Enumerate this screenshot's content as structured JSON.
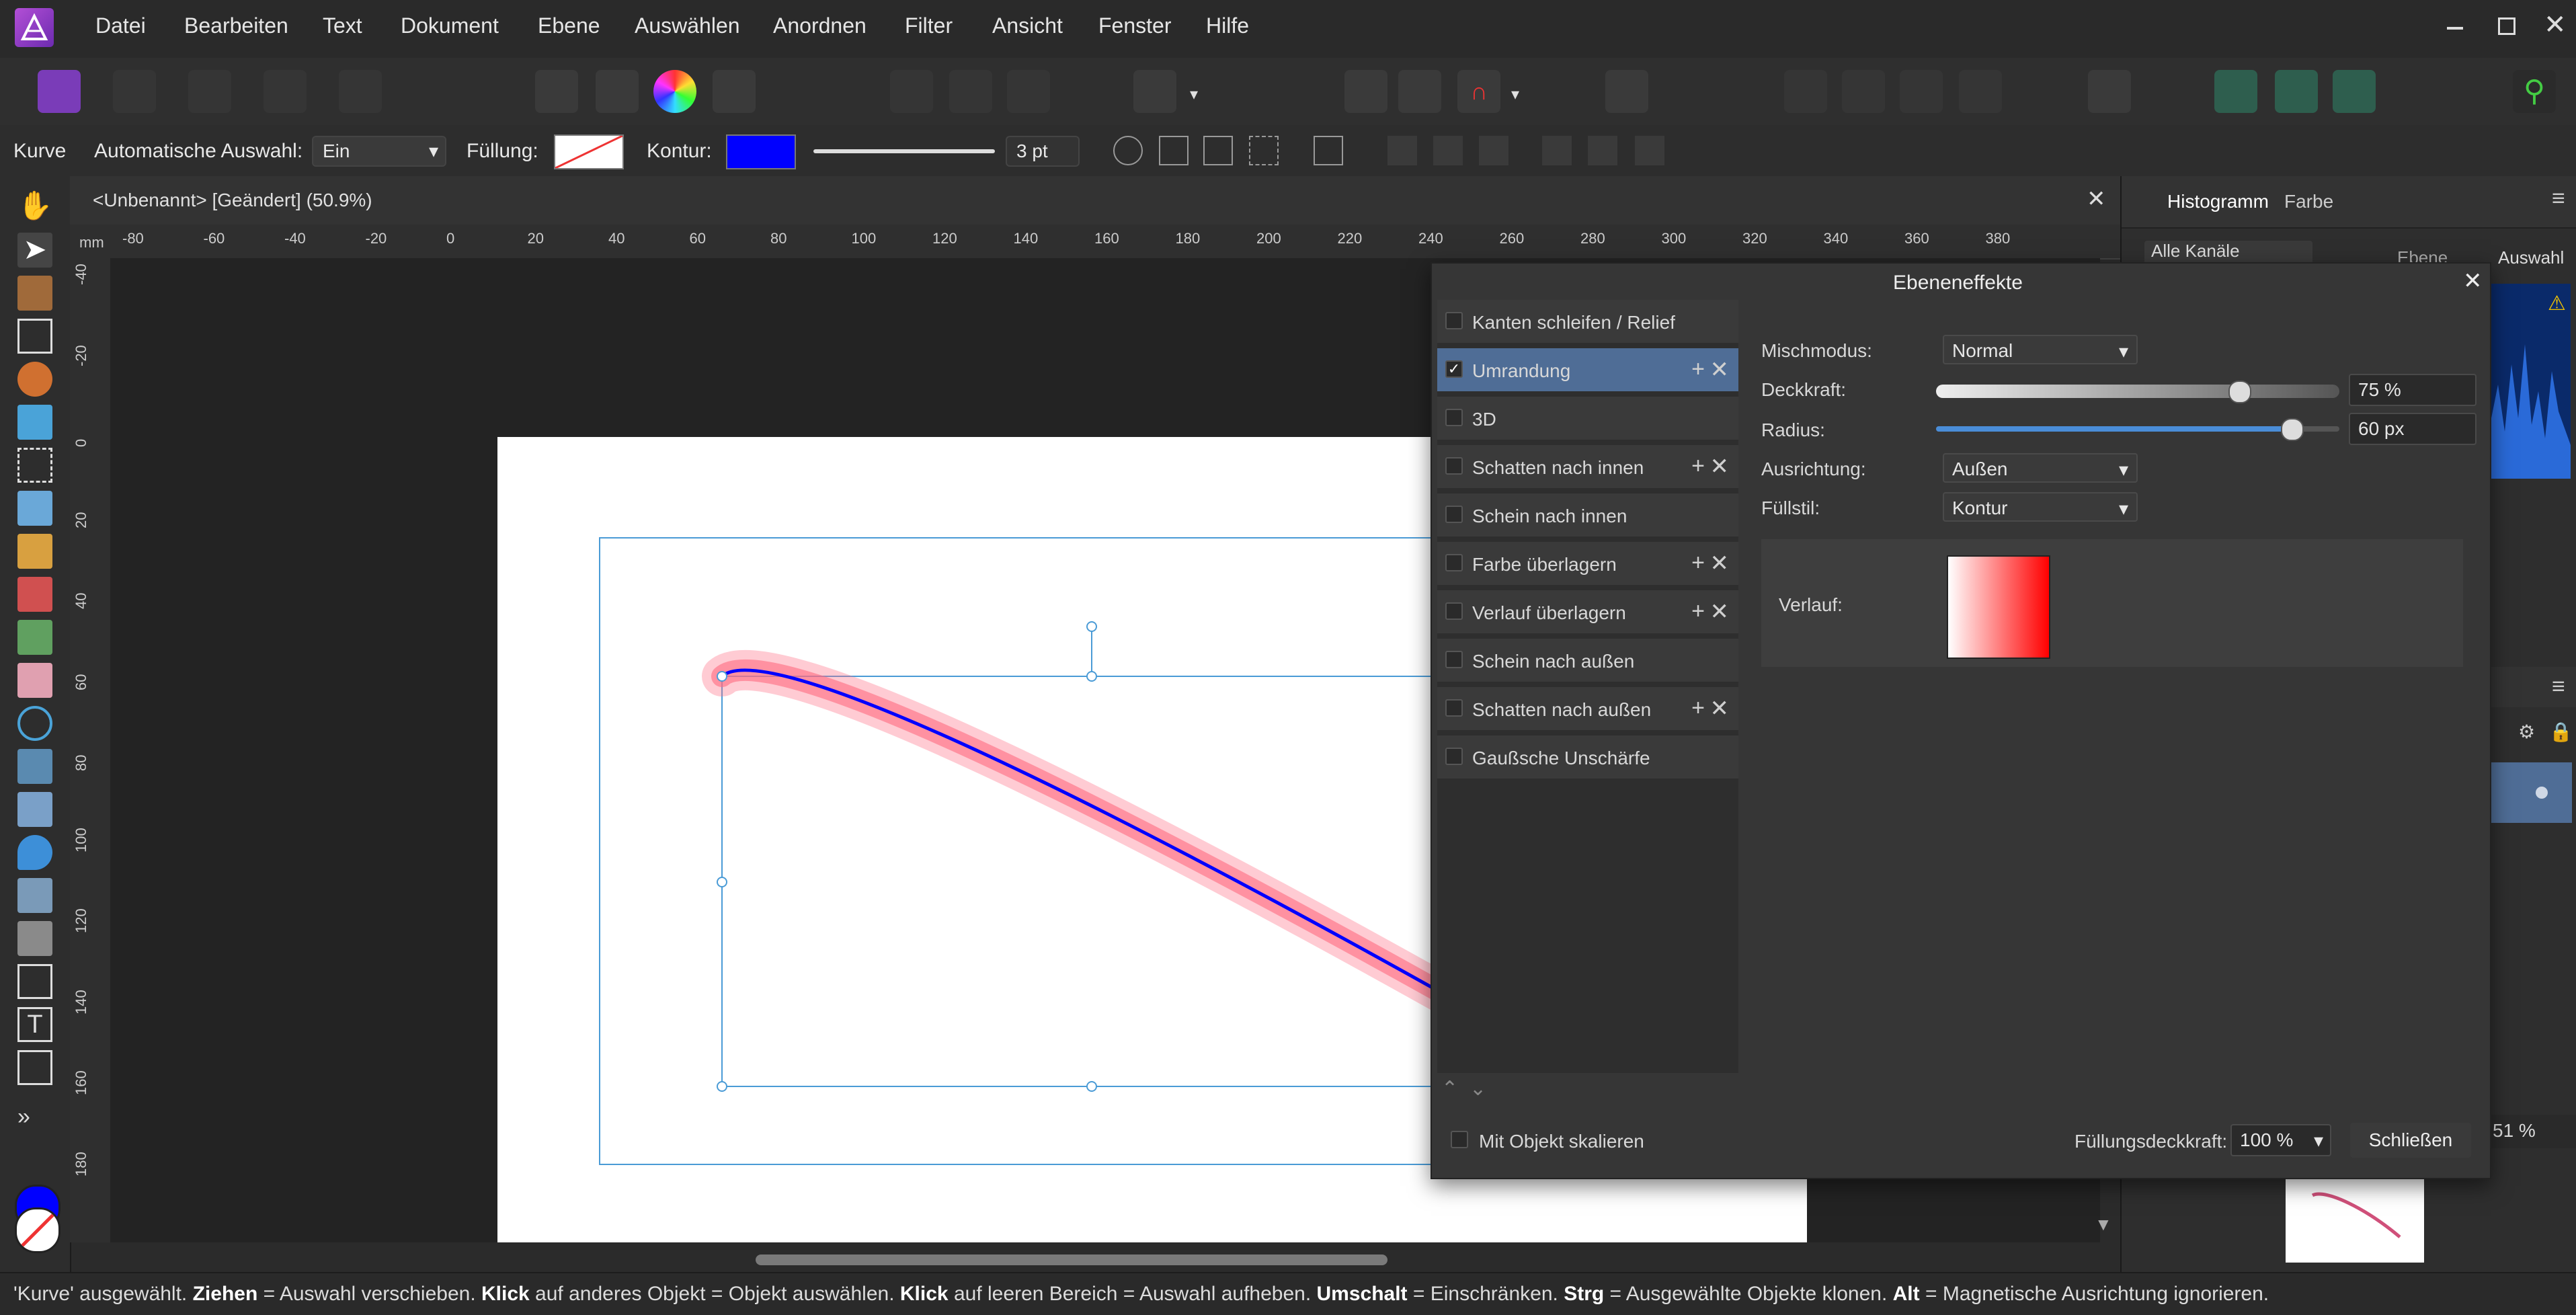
{
  "menubar": {
    "items": [
      "Datei",
      "Bearbeiten",
      "Text",
      "Dokument",
      "Ebene",
      "Auswählen",
      "Anordnen",
      "Filter",
      "Ansicht",
      "Fenster",
      "Hilfe"
    ],
    "logo": "affinity-designer-logo-icon",
    "window_controls": [
      "minimize-icon",
      "restore-icon",
      "close-icon"
    ]
  },
  "contextbar": {
    "tool_name": "Kurve",
    "auto_select_label": "Automatische Auswahl:",
    "auto_select_value": "Ein",
    "fill_label": "Füllung:",
    "stroke_label": "Kontur:",
    "stroke_width": "3 pt",
    "stroke_color": "#0000ff"
  },
  "document": {
    "tab_title": "<Unbenannt> [Geändert] (50.9%)",
    "ruler_unit": "mm",
    "ruler_h_ticks": [
      "-80",
      "-60",
      "-40",
      "-20",
      "0",
      "20",
      "40",
      "60",
      "80",
      "100",
      "120",
      "140",
      "160",
      "180",
      "200",
      "220",
      "240",
      "260",
      "280",
      "300",
      "320",
      "340",
      "360",
      "380"
    ],
    "ruler_v_ticks": [
      "-40",
      "-20",
      "0",
      "20",
      "40",
      "60",
      "80",
      "100",
      "120",
      "140",
      "160",
      "180"
    ]
  },
  "right_panel": {
    "tabs": [
      "Histogramm",
      "Farbe"
    ],
    "channel_select": "Alle Kanäle",
    "checkbox_layer": "Ebene",
    "checkbox_selection": "Auswahl",
    "zoom_value": "51 %"
  },
  "dialog": {
    "title": "Ebeneneffekte",
    "effects": [
      {
        "label": "Kanten schleifen / Relief",
        "checked": false,
        "has_add": false
      },
      {
        "label": "Umrandung",
        "checked": true,
        "has_add": true,
        "active": true
      },
      {
        "label": "3D",
        "checked": false,
        "has_add": false
      },
      {
        "label": "Schatten nach innen",
        "checked": false,
        "has_add": true
      },
      {
        "label": "Schein nach innen",
        "checked": false,
        "has_add": false
      },
      {
        "label": "Farbe überlagern",
        "checked": false,
        "has_add": true
      },
      {
        "label": "Verlauf überlagern",
        "checked": false,
        "has_add": true
      },
      {
        "label": "Schein nach außen",
        "checked": false,
        "has_add": false
      },
      {
        "label": "Schatten nach außen",
        "checked": false,
        "has_add": true
      },
      {
        "label": "Gaußsche Unschärfe",
        "checked": false,
        "has_add": false
      }
    ],
    "blend_mode_label": "Mischmodus:",
    "blend_mode_value": "Normal",
    "opacity_label": "Deckkraft:",
    "opacity_value": "75 %",
    "opacity_fraction": 0.75,
    "radius_label": "Radius:",
    "radius_value": "60 px",
    "radius_fraction": 0.88,
    "alignment_label": "Ausrichtung:",
    "alignment_value": "Außen",
    "fill_style_label": "Füllstil:",
    "fill_style_value": "Kontur",
    "gradient_label": "Verlauf:",
    "gradient_start": "#ffffff",
    "gradient_end": "#ff0000",
    "scale_with_object_label": "Mit Objekt skalieren",
    "fill_opacity_label": "Füllungsdeckkraft:",
    "fill_opacity_value": "100 %",
    "close_label": "Schließen"
  },
  "status": {
    "parts": [
      {
        "t": "'Kurve' ausgewählt. ",
        "b": false
      },
      {
        "t": "Ziehen",
        "b": true
      },
      {
        "t": " = Auswahl verschieben. ",
        "b": false
      },
      {
        "t": "Klick",
        "b": true
      },
      {
        "t": " auf anderes Objekt = Objekt auswählen. ",
        "b": false
      },
      {
        "t": "Klick",
        "b": true
      },
      {
        "t": " auf leeren Bereich = Auswahl aufheben. ",
        "b": false
      },
      {
        "t": "Umschalt",
        "b": true
      },
      {
        "t": " = Einschränken. ",
        "b": false
      },
      {
        "t": "Strg",
        "b": true
      },
      {
        "t": " = Ausgewählte Objekte klonen. ",
        "b": false
      },
      {
        "t": "Alt",
        "b": true
      },
      {
        "t": " = Magnetische Ausrichtung ignorieren.",
        "b": false
      }
    ]
  }
}
